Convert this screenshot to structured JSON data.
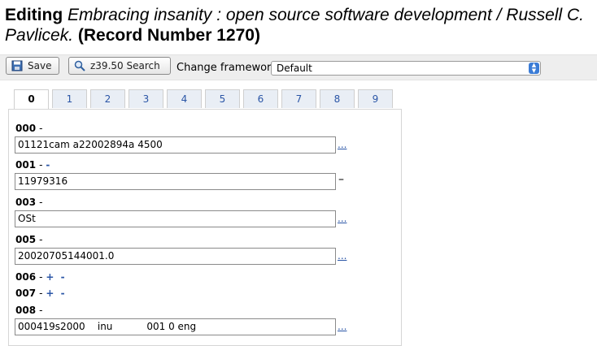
{
  "header": {
    "prefix": "Editing",
    "title": "Embracing insanity : open source software development / Russell C. Pavlicek.",
    "record": "(Record Number 1270)"
  },
  "toolbar": {
    "save_label": "Save",
    "search_label": "z39.50 Search",
    "framework_label": "Change framework:",
    "framework_value": "Default"
  },
  "tabs": [
    "0",
    "1",
    "2",
    "3",
    "4",
    "5",
    "6",
    "7",
    "8",
    "9"
  ],
  "active_tab": "0",
  "fields": {
    "f000": {
      "tag": "000",
      "sep": "-",
      "value": "01121cam a22002894a 4500",
      "link": "..."
    },
    "f001": {
      "tag": "001",
      "sep": "-",
      "pm": "-",
      "value": "11979316",
      "trail": "–"
    },
    "f003": {
      "tag": "003",
      "sep": "-",
      "value": "OSt",
      "link": "..."
    },
    "f005": {
      "tag": "005",
      "sep": "-",
      "value": "20020705144001.0",
      "link": "..."
    },
    "f006": {
      "tag": "006",
      "sep": "-",
      "pm": "+ -"
    },
    "f007": {
      "tag": "007",
      "sep": "-",
      "pm": "+ -"
    },
    "f008": {
      "tag": "008",
      "sep": "-",
      "value": "000419s2000    inu           001 0 eng",
      "link": "..."
    }
  },
  "icons": {
    "save": "floppy-disk-icon",
    "search": "magnifier-icon",
    "select_arrow": "updown-arrow-icon"
  }
}
